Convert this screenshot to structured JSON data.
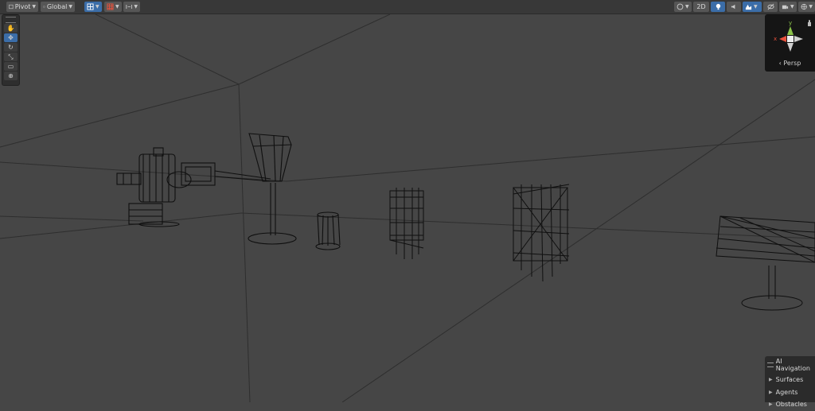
{
  "toolbar": {
    "pivot_label": "Pivot",
    "global_label": "Global",
    "mode_2d_label": "2D"
  },
  "tools": [
    "hand-tool",
    "move-tool",
    "rotate-tool",
    "scale-tool",
    "rect-tool",
    "transform-tool"
  ],
  "active_tool": "move-tool",
  "gizmo": {
    "y_label": "y",
    "x_label": "x",
    "projection_label": "‹ Persp",
    "colors": {
      "y": "#8bc34a",
      "x": "#e8513c",
      "neutral": "#cfcfcf"
    }
  },
  "ai_navigation": {
    "title": "AI Navigation",
    "items": [
      "Surfaces",
      "Agents",
      "Obstacles"
    ]
  },
  "colors": {
    "viewport_bg": "#464646",
    "toolbar_bg": "#383838",
    "active_accent": "#3b6da8",
    "wireframe": "#111111",
    "grid_line": "#2c2c2c"
  }
}
